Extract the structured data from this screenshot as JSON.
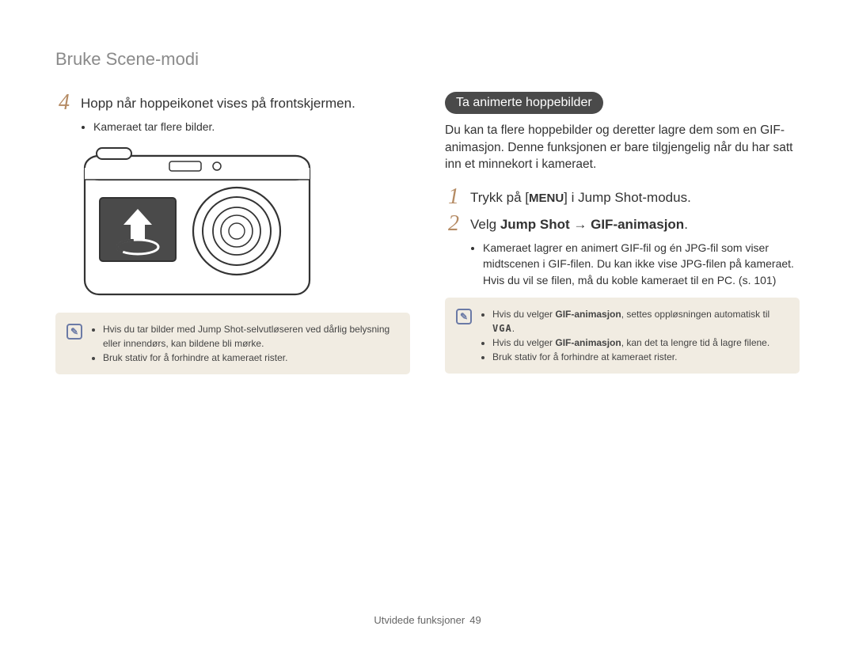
{
  "header": {
    "title": "Bruke Scene-modi"
  },
  "left": {
    "step4": {
      "num": "4",
      "text": "Hopp når hoppeikonet vises på frontskjermen.",
      "bullet1": "Kameraet tar flere bilder."
    },
    "note": {
      "items": [
        "Hvis du tar bilder med Jump Shot-selvutløseren ved dårlig belysning eller innendørs, kan bildene bli mørke.",
        "Bruk stativ for å forhindre at kameraet rister."
      ]
    }
  },
  "right": {
    "pill": "Ta animerte hoppebilder",
    "intro": "Du kan ta flere hoppebilder og deretter lagre dem som en GIF-animasjon. Denne funksjonen er bare tilgjengelig når du har satt inn et minnekort i kameraet.",
    "step1": {
      "num": "1",
      "pre": "Trykk på [",
      "menu": "MENU",
      "post": "] i Jump Shot-modus."
    },
    "step2": {
      "num": "2",
      "pre": "Velg ",
      "bold1": "Jump Shot",
      "arrow": " → ",
      "bold2": "GIF-animasjon",
      "post": ".",
      "bullet1": "Kameraet lagrer en animert GIF-fil og én JPG-fil som viser midtscenen i GIF-filen. Du kan ikke vise JPG-filen på kameraet. Hvis du vil se filen, må du koble kameraet til en PC. (s. 101)"
    },
    "note": {
      "item1_pre": "Hvis du velger ",
      "item1_bold": "GIF-animasjon",
      "item1_post": ", settes oppløsningen automatisk til ",
      "item1_vga": "VGA",
      "item1_end": ".",
      "item2_pre": "Hvis du velger ",
      "item2_bold": "GIF-animasjon",
      "item2_post": ", kan det ta lengre tid å lagre filene.",
      "item3": "Bruk stativ for å forhindre at kameraet rister."
    }
  },
  "footer": {
    "label": "Utvidede funksjoner",
    "page": "49"
  }
}
